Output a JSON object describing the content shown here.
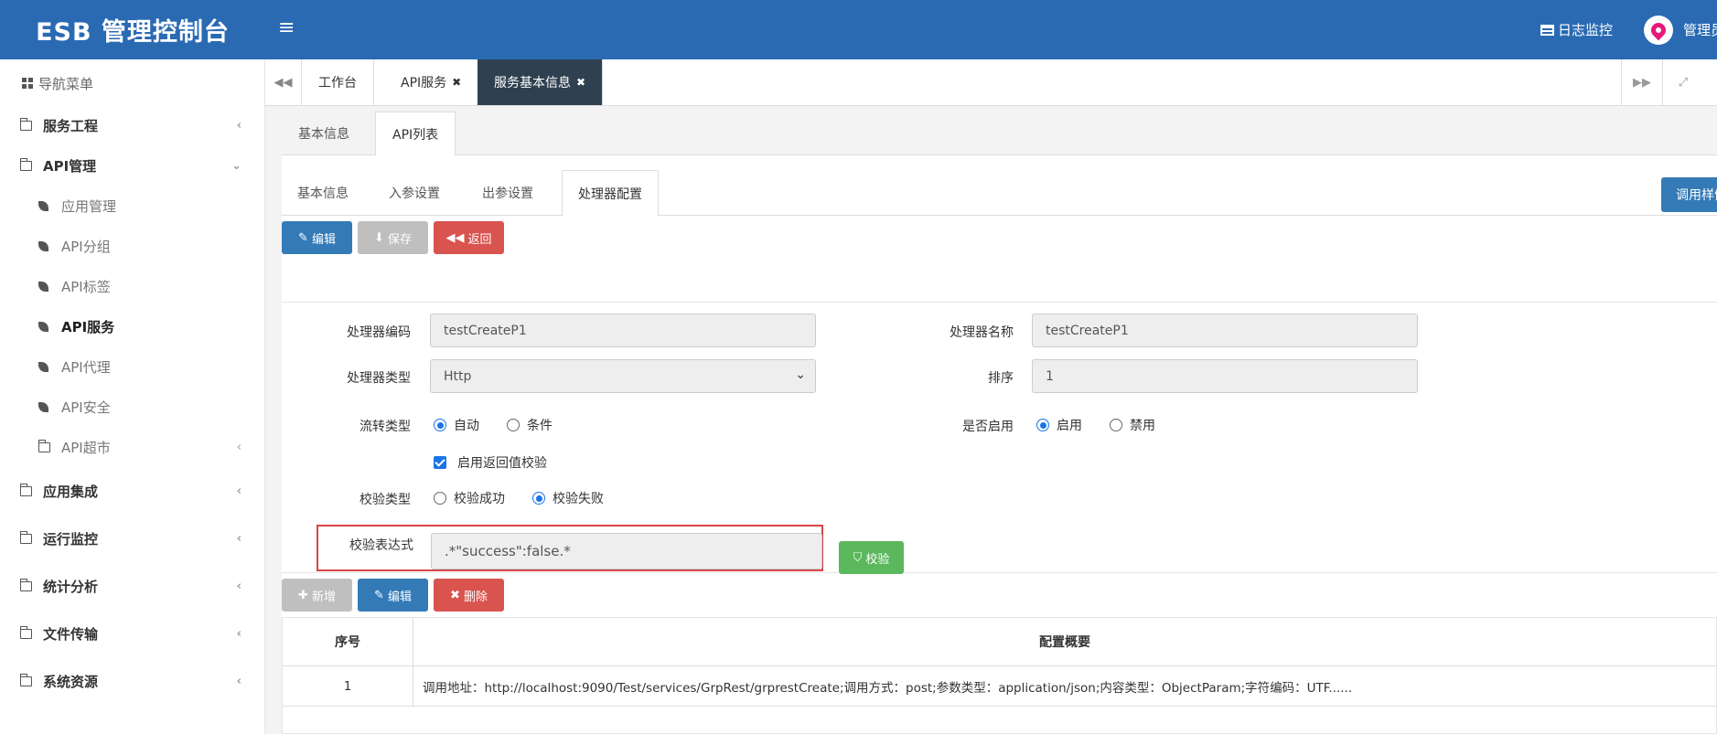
{
  "app": {
    "title": "ESB 管理控制台",
    "menu_toggle": "≡",
    "log_monitor": "日志监控",
    "user_name": "管理员"
  },
  "sidebar": {
    "header": "导航菜单",
    "items": [
      {
        "label": "服务工程",
        "level": "top",
        "expanded": false
      },
      {
        "label": "API管理",
        "level": "top",
        "expanded": true
      },
      {
        "label": "应用管理",
        "level": "sub"
      },
      {
        "label": "API分组",
        "level": "sub"
      },
      {
        "label": "API标签",
        "level": "sub"
      },
      {
        "label": "API服务",
        "level": "sub",
        "active": true
      },
      {
        "label": "API代理",
        "level": "sub"
      },
      {
        "label": "API安全",
        "level": "sub"
      },
      {
        "label": "API超市",
        "level": "sub"
      },
      {
        "label": "应用集成",
        "level": "top"
      },
      {
        "label": "运行监控",
        "level": "top"
      },
      {
        "label": "统计分析",
        "level": "top"
      },
      {
        "label": "文件传输",
        "level": "top"
      },
      {
        "label": "系统资源",
        "level": "top"
      }
    ]
  },
  "page_tabs": [
    {
      "label": "工作台",
      "closable": false
    },
    {
      "label": "API服务",
      "closable": true
    },
    {
      "label": "服务基本信息",
      "closable": true,
      "active": true
    }
  ],
  "level1_tabs": [
    {
      "label": "基本信息"
    },
    {
      "label": "API列表",
      "active": true
    }
  ],
  "level2_tabs": [
    {
      "label": "基本信息"
    },
    {
      "label": "入参设置"
    },
    {
      "label": "出参设置"
    },
    {
      "label": "处理器配置",
      "active": true
    }
  ],
  "call_button": "调用样例",
  "toolbar": {
    "edit": "编辑",
    "save": "保存",
    "back": "返回"
  },
  "form": {
    "processor_code_label": "处理器编码",
    "processor_code_value": "testCreateP1",
    "processor_name_label": "处理器名称",
    "processor_name_value": "testCreateP1",
    "processor_type_label": "处理器类型",
    "processor_type_value": "Http",
    "order_label": "排序",
    "order_value": "1",
    "flow_type_label": "流转类型",
    "flow_type_options": [
      "自动",
      "条件"
    ],
    "flow_type_selected": "自动",
    "enabled_label": "是否启用",
    "enabled_options": [
      "启用",
      "禁用"
    ],
    "enabled_selected": "启用",
    "return_check_label": "启用返回值校验",
    "return_check_checked": true,
    "check_type_label": "校验类型",
    "check_type_options": [
      "校验成功",
      "校验失败"
    ],
    "check_type_selected": "校验失败",
    "check_expr_label": "校验表达式",
    "check_expr_value": ".*\"success\":false.*",
    "check_button": "校验"
  },
  "table_toolbar": {
    "add": "新增",
    "edit": "编辑",
    "delete": "删除"
  },
  "table": {
    "columns": [
      "序号",
      "配置概要"
    ],
    "rows": [
      {
        "index": "1",
        "summary": "调用地址：http://localhost:9090/Test/services/GrpRest/grprestCreate;调用方式：post;参数类型：application/json;内容类型：ObjectParam;字符编码：UTF......"
      }
    ]
  },
  "colors": {
    "topbar": "#2a6ab3",
    "primary": "#337ab7",
    "danger": "#d9534f",
    "success": "#5cb85c",
    "active_tab": "#2f4050",
    "highlight": "#d64545"
  }
}
